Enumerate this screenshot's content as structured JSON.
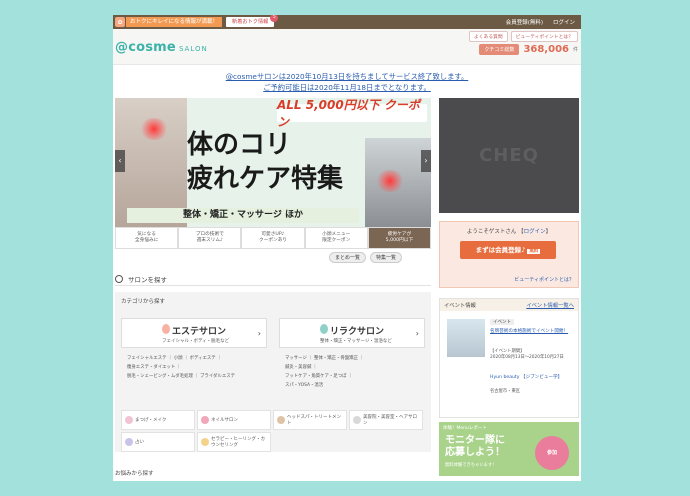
{
  "topbar": {
    "promo_text": "おトクにキレイになる情報が満載！",
    "new_label": "新着おトク情報",
    "new_count": "5",
    "links": [
      "会員登録(無料)",
      "ログイン"
    ]
  },
  "header": {
    "logo": "@cosme",
    "logo_sub": "SALON",
    "links": [
      "よくある質問",
      "ビューティポイントとは？"
    ],
    "kuchikomi_label": "クチコミ総数",
    "kuchikomi_count": "368,006",
    "kuchikomi_unit": "件"
  },
  "notice": {
    "line1": "@cosmeサロンは2020年10月13日を持ちましてサービス終了致します。",
    "line2": "ご予約可能日は2020年11月18日までとなります。"
  },
  "banner": {
    "coupon": "ALL 5,000円以下 クーポン",
    "title_line1": "体のコリ",
    "title_line2": "疲れケア特集",
    "sub": "整体・矯正・マッサージ ほか",
    "prev": "‹",
    "next": "›"
  },
  "thumbs": [
    {
      "line1": "気になる",
      "line2": "全身悩みに"
    },
    {
      "line1": "プロの技術で",
      "line2": "週末スリム♪"
    },
    {
      "line1": "可愛さUP♪",
      "line2": "クーポンあり"
    },
    {
      "line1": "小顔メニュー",
      "line2": "限定クーポン"
    },
    {
      "line1": "疲労ケアが",
      "line2": "5,000円以下"
    }
  ],
  "more_links": [
    "まとめ一覧",
    "特集一覧"
  ],
  "search": {
    "title": "サロンを探す",
    "category_heading": "カテゴリから探す",
    "esthe": {
      "name": "エステサロン",
      "desc": "フェイシャル・ボディ・脱毛など"
    },
    "relax": {
      "name": "リラクサロン",
      "desc": "整体・矯正・マッサージ・温浴など"
    },
    "esthe_sub": [
      "フェイシャルエステ ｜ 小顔 ｜ ボディエステ ｜",
      "痩身エステ・ダイエット ｜",
      "脱毛・シェービング・ムダ毛処理 ｜ ブライダルエステ"
    ],
    "relax_sub": [
      "マッサージ ｜ 整体・矯正・骨盤矯正 ｜",
      "鍼灸・美容鍼 ｜",
      "フットケア・角質ケア・足つぼ ｜",
      "スパ・YOSA・温活"
    ],
    "tiles": [
      "まつげ・メイク",
      "ネイルサロン",
      "ヘッドスパ・トリートメント",
      "美容院・美容室・ヘアサロン",
      "占い",
      "セラピー・ヒーリング・カウンセリング"
    ],
    "nayami_heading": "お悩みから探す"
  },
  "side": {
    "ad_text": "CHEQ",
    "guest_greet": "ようこそゲストさん",
    "login_link": "ログイン",
    "register": "まずは会員登録♪",
    "register_free": "無料",
    "point_link": "ビューティポイントとは？",
    "event_heading": "イベント情報",
    "event_more": "イベント情報一覧へ",
    "event_tag": "イベント",
    "event_title": "名牌芸術の本格施術でイベント開催！",
    "event_period_label": "【イベント期間】",
    "event_period": "2020年08月13日～2020年10月27日",
    "event2_title": "Hyun beauty 【ジブンビュー学】",
    "event2_loc": "名古屋市・東区",
    "monitor_small": "体験！Menuレポート",
    "monitor_big1": "モニター隊に",
    "monitor_big2": "応募しよう！",
    "monitor_mini": "無料体験できちゃいます！",
    "monitor_badge": "参加"
  }
}
